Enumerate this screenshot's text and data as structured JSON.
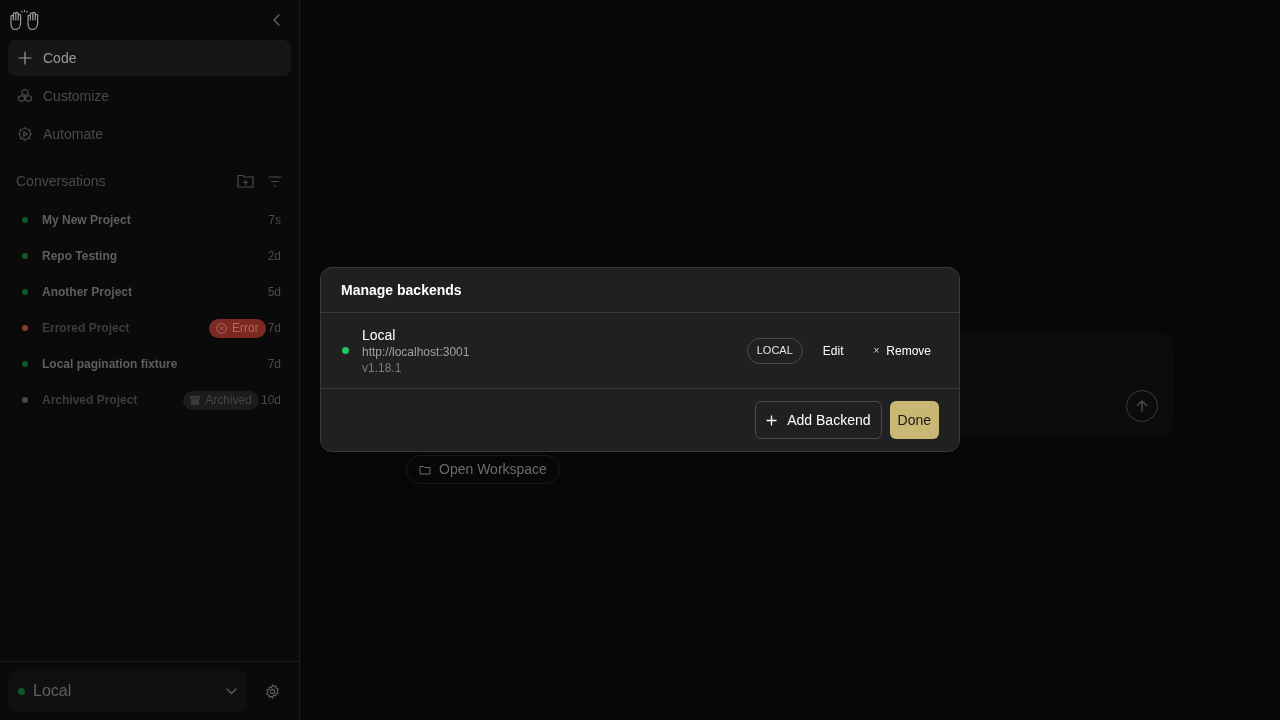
{
  "sidebar": {
    "nav": [
      {
        "label": "Code",
        "selected": true
      },
      {
        "label": "Customize",
        "selected": false
      },
      {
        "label": "Automate",
        "selected": false
      }
    ],
    "section_title": "Conversations",
    "conversations": [
      {
        "title": "My New Project",
        "time": "7s",
        "color": "#0d5a29",
        "muted": false
      },
      {
        "title": "Repo Testing",
        "time": "2d",
        "color": "#0d5a29",
        "muted": false
      },
      {
        "title": "Another Project",
        "time": "5d",
        "color": "#0d5a29",
        "muted": false
      },
      {
        "title": "Errored Project",
        "time": "7d",
        "color": "#8b3a30",
        "muted": true,
        "badge": {
          "kind": "error",
          "label": "Error"
        }
      },
      {
        "title": "Local pagination fixture",
        "time": "7d",
        "color": "#0d5a29",
        "muted": false
      },
      {
        "title": "Archived Project",
        "time": "10d",
        "color": "#4a4a4a",
        "muted": true,
        "badge": {
          "kind": "archived",
          "label": "Archived"
        }
      }
    ],
    "backend_selector": {
      "label": "Local",
      "color": "#0d5a29"
    }
  },
  "main": {
    "open_workspace": "Open Workspace"
  },
  "dialog": {
    "title": "Manage backends",
    "backends": [
      {
        "name": "Local",
        "url": "http://localhost:3001",
        "version": "v1.18.1",
        "color": "#22c55e",
        "tag": "LOCAL",
        "edit": "Edit",
        "remove": "Remove",
        "remove_icon": "×"
      }
    ],
    "buttons": [
      {
        "kind": "secondary",
        "label": "Add Backend"
      },
      {
        "kind": "primary",
        "label": "Done"
      }
    ]
  }
}
